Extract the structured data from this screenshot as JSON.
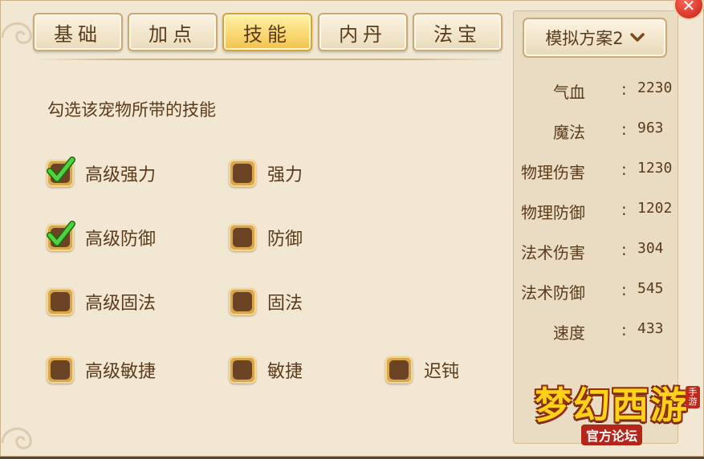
{
  "tabs": [
    {
      "label": "基础",
      "active": false
    },
    {
      "label": "加点",
      "active": false
    },
    {
      "label": "技能",
      "active": true
    },
    {
      "label": "内丹",
      "active": false
    },
    {
      "label": "法宝",
      "active": false
    }
  ],
  "instruction": "勾选该宠物所带的技能",
  "skills": [
    {
      "label": "高级强力",
      "checked": true
    },
    {
      "label": "强力",
      "checked": false
    },
    {
      "label": "高级防御",
      "checked": true
    },
    {
      "label": "防御",
      "checked": false
    },
    {
      "label": "高级固法",
      "checked": false
    },
    {
      "label": "固法",
      "checked": false
    },
    {
      "label": "高级敏捷",
      "checked": false
    },
    {
      "label": "敏捷",
      "checked": false
    },
    {
      "label": "迟钝",
      "checked": false
    }
  ],
  "plan": {
    "label": "模拟方案2",
    "icon": "chevron-down-icon"
  },
  "stats": [
    {
      "name": "气血",
      "value": "2230"
    },
    {
      "name": "魔法",
      "value": "963"
    },
    {
      "name": "物理伤害",
      "value": "1230"
    },
    {
      "name": "物理防御",
      "value": "1202"
    },
    {
      "name": "法术伤害",
      "value": "304"
    },
    {
      "name": "法术防御",
      "value": "545"
    },
    {
      "name": "速度",
      "value": "433"
    }
  ],
  "logo": {
    "main": "梦幻西游",
    "sub": "官方论坛",
    "tag": "手游"
  },
  "colors": {
    "accent": "#f3c24a",
    "text": "#5a3b1c",
    "checkbox": "#d8a64c",
    "check": "#3db83a"
  }
}
